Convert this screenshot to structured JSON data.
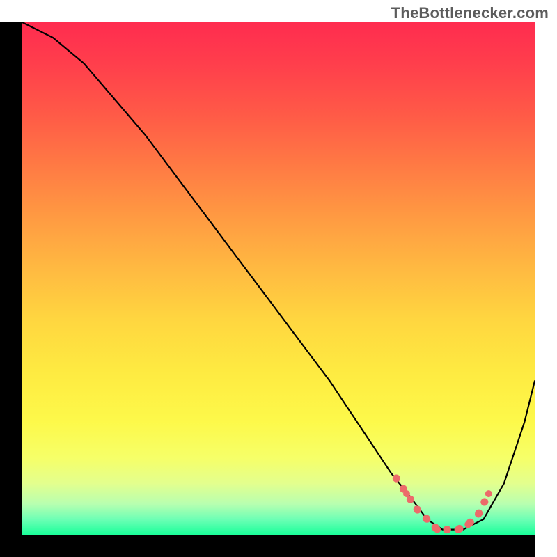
{
  "watermark": "TheBottlenecker.com",
  "chart_data": {
    "type": "line",
    "title": "",
    "xlabel": "",
    "ylabel": "",
    "xlim": [
      0,
      100
    ],
    "ylim": [
      0,
      100
    ],
    "series": [
      {
        "name": "bottleneck-curve",
        "x": [
          0,
          6,
          12,
          18,
          24,
          30,
          36,
          42,
          48,
          54,
          60,
          64,
          68,
          72,
          76,
          79,
          82,
          86,
          90,
          94,
          98,
          100
        ],
        "values": [
          100,
          97,
          92,
          85,
          78,
          70,
          62,
          54,
          46,
          38,
          30,
          24,
          18,
          12,
          7,
          3,
          1,
          1,
          3,
          10,
          22,
          30
        ]
      }
    ],
    "markers": {
      "name": "optimal-range",
      "x": [
        73,
        75,
        77,
        79,
        81,
        83,
        85,
        87,
        89,
        91
      ],
      "values": [
        11,
        8,
        5,
        3,
        1,
        1,
        1,
        2,
        4,
        8
      ],
      "color": "#ec6a6a",
      "size": 10
    },
    "background_gradient": {
      "top_color": "#ff2c4f",
      "mid_color": "#ffd640",
      "bottom_color": "#1aff9a"
    },
    "axis_style": {
      "thickness_px": 32,
      "color": "#000000"
    }
  }
}
